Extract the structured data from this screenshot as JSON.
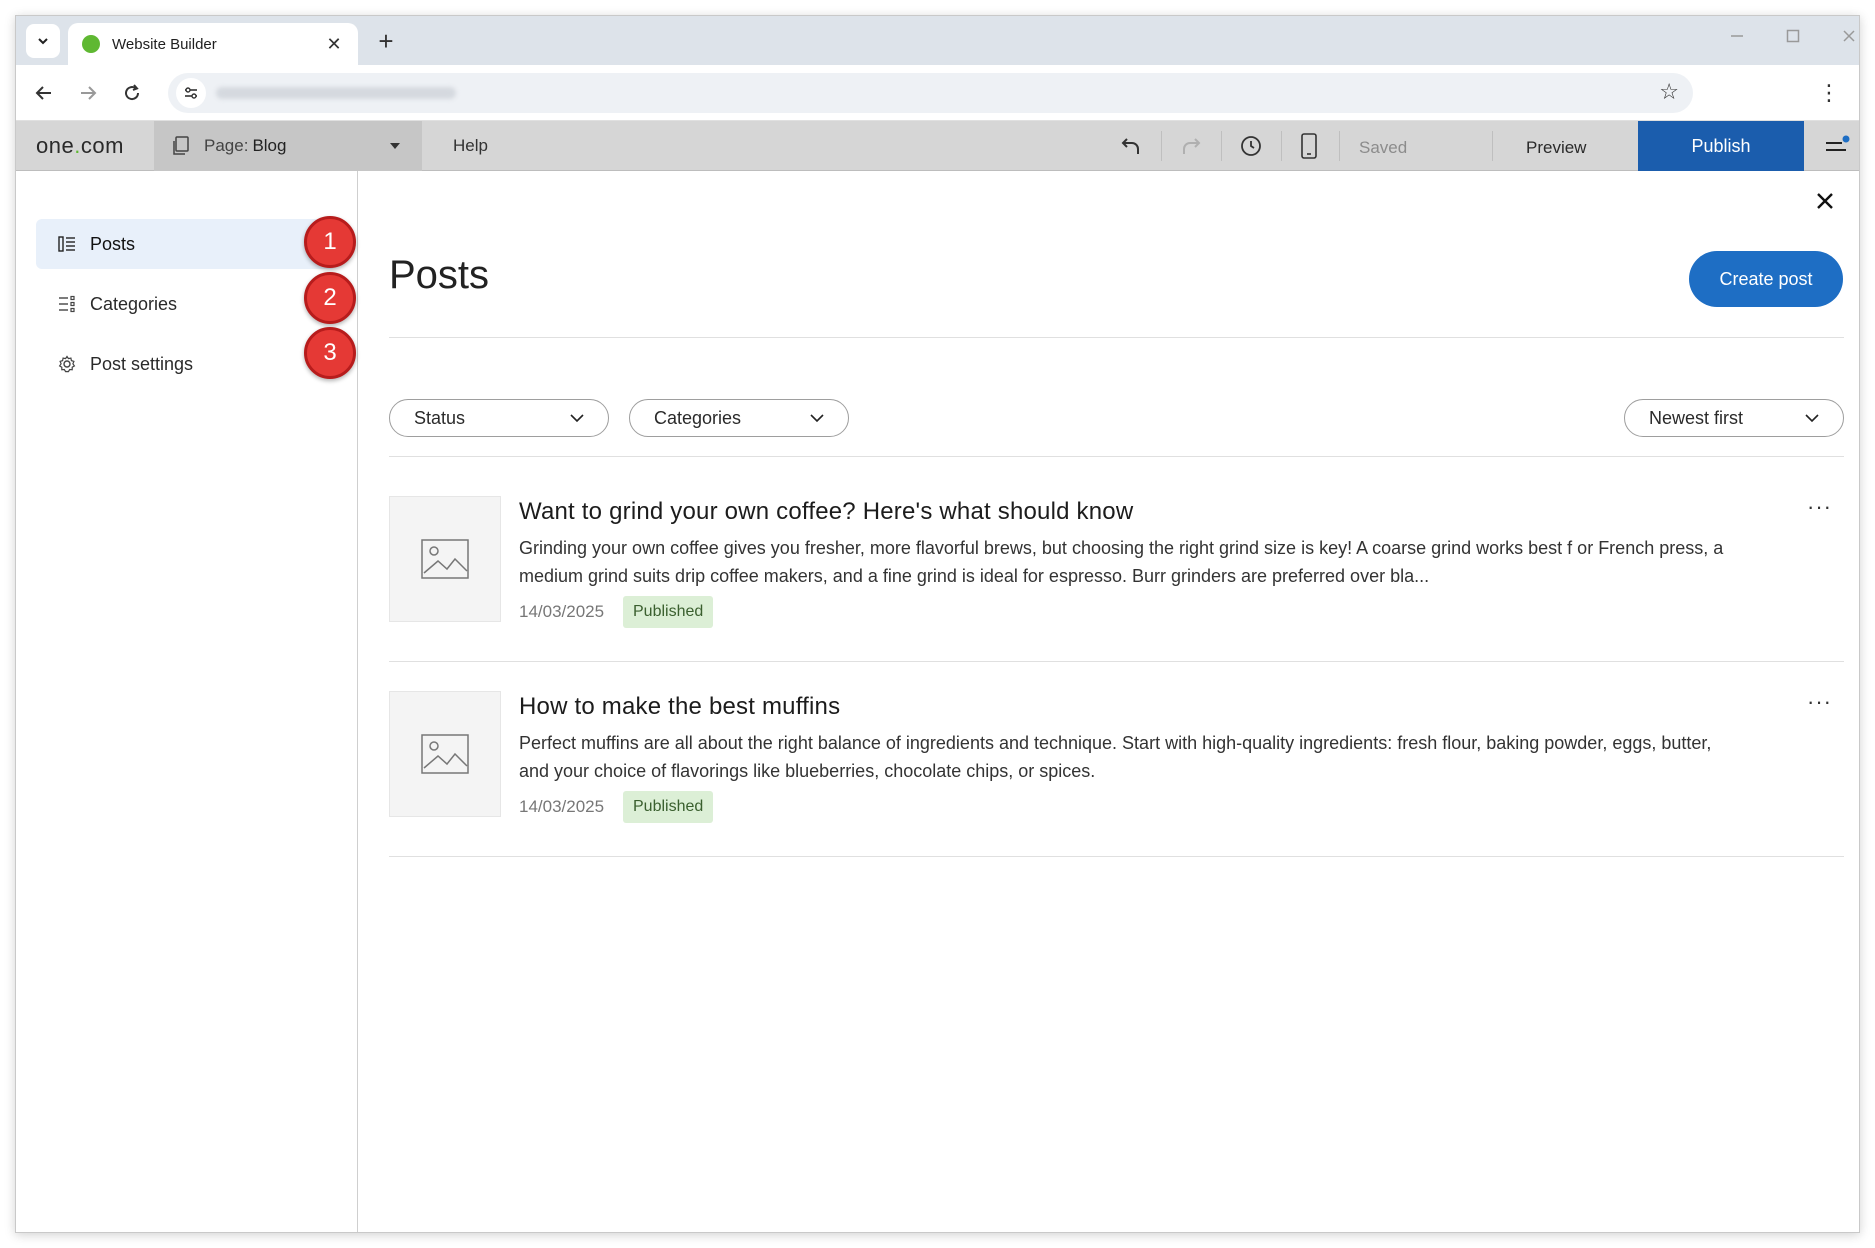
{
  "browser": {
    "tab_title": "Website Builder",
    "new_tab_symbol": "+",
    "tab_close_symbol": "✕",
    "favicon_color": "#5fb832"
  },
  "toolbar": {
    "logo_prefix": "one",
    "logo_dot": ".",
    "logo_suffix": "com",
    "page_label": "Page:",
    "page_value": "Blog",
    "help_label": "Help",
    "saved_label": "Saved",
    "preview_label": "Preview",
    "publish_label": "Publish",
    "publish_color": "#1b5dad"
  },
  "sidebar": {
    "items": [
      {
        "label": "Posts",
        "icon": "list-icon",
        "active": true,
        "step": "1"
      },
      {
        "label": "Categories",
        "icon": "categories-icon",
        "active": false,
        "step": "2"
      },
      {
        "label": "Post settings",
        "icon": "gear-icon",
        "active": false,
        "step": "3"
      }
    ]
  },
  "main": {
    "title": "Posts",
    "create_label": "Create post",
    "filters": {
      "status": "Status",
      "categories": "Categories",
      "sort": "Newest first"
    },
    "posts": [
      {
        "title": "Want to grind your own coffee? Here's what should know",
        "excerpt": "Grinding your own coffee gives you fresher, more flavorful brews, but choosing the right grind size is key! A coarse grind works best f or French press, a medium grind suits drip coffee makers, and a fine grind is ideal for espresso. Burr grinders are preferred over bla...",
        "date": "14/03/2025",
        "status": "Published",
        "more": "···"
      },
      {
        "title": "How to make the best muffins",
        "excerpt": "Perfect muffins are all about the right balance of ingredients and technique. Start with high-quality ingredients: fresh flour, baking powder, eggs, butter, and your choice of flavorings like blueberries, chocolate chips, or spices.",
        "date": "14/03/2025",
        "status": "Published",
        "more": "···"
      }
    ]
  },
  "colors": {
    "accent": "#1e6ec4",
    "badge_red": "#e53935",
    "published_bg": "#dcefd6"
  }
}
